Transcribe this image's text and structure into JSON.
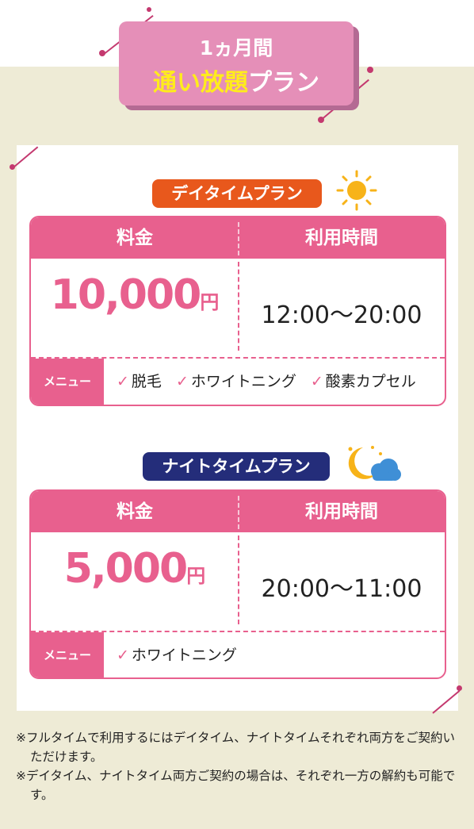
{
  "header": {
    "line1": "1ヵ月間",
    "line2_highlight": "通い放題",
    "line2_rest": "プラン"
  },
  "plans": [
    {
      "tag": "デイタイムプラン",
      "tag_color": "#e8581c",
      "fee_label": "料金",
      "time_label": "利用時間",
      "price": "10,000",
      "yen": "円",
      "hours": "12:00〜20:00",
      "menu_label": "メニュー",
      "menu_items": [
        "脱毛",
        "ホワイトニング",
        "酸素カプセル"
      ],
      "icon": "sun-icon"
    },
    {
      "tag": "ナイトタイムプラン",
      "tag_color": "#242d7a",
      "fee_label": "料金",
      "time_label": "利用時間",
      "price": "5,000",
      "yen": "円",
      "hours": "20:00〜11:00",
      "menu_label": "メニュー",
      "menu_items": [
        "ホワイトニング"
      ],
      "icon": "moon-cloud-icon"
    }
  ],
  "notes": [
    "※フルタイムで利用するにはデイタイム、ナイトタイムそれぞれ両方をご契約いただけます。",
    "※デイタイム、ナイトタイム両方ご契約の場合は、それぞれ一方の解約も可能です。"
  ],
  "colors": {
    "accent": "#e8608e",
    "header_pink": "#e58fb8",
    "highlight": "#ffec1c",
    "beige": "#eeebd6"
  }
}
